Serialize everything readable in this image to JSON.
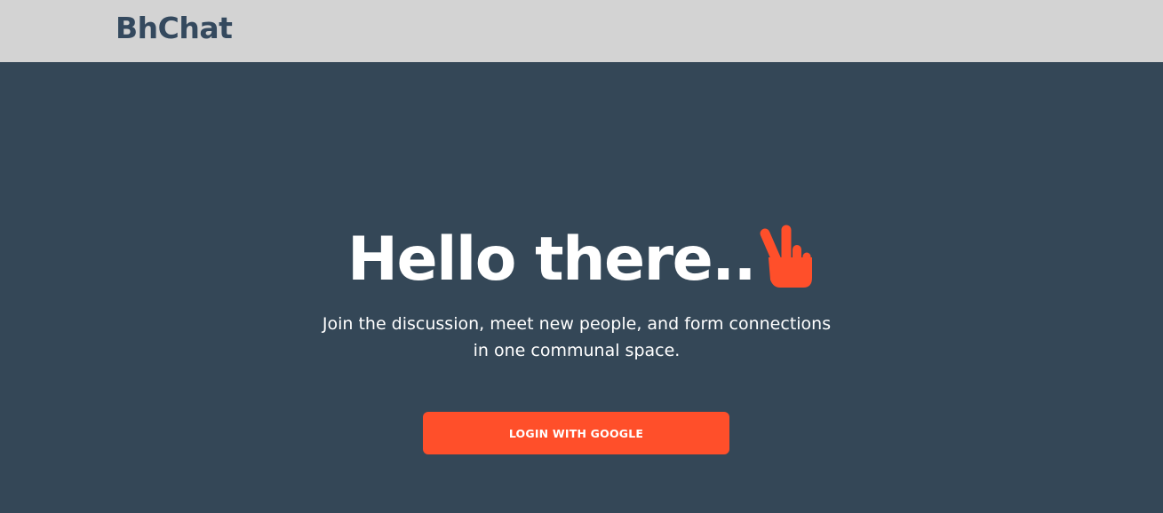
{
  "navbar": {
    "brand": "BhChat"
  },
  "hero": {
    "headline": "Hello there..",
    "headline_icon": "victory-hand-icon",
    "subtitle": "Join the discussion, meet new people, and form connections in one communal space.",
    "login_button_label": "LOGIN WITH GOOGLE"
  },
  "colors": {
    "navbar_bg": "#d3d3d3",
    "brand_text": "#34495e",
    "hero_bg": "#344757",
    "accent": "#ff4f2a",
    "text_light": "#ffffff"
  }
}
